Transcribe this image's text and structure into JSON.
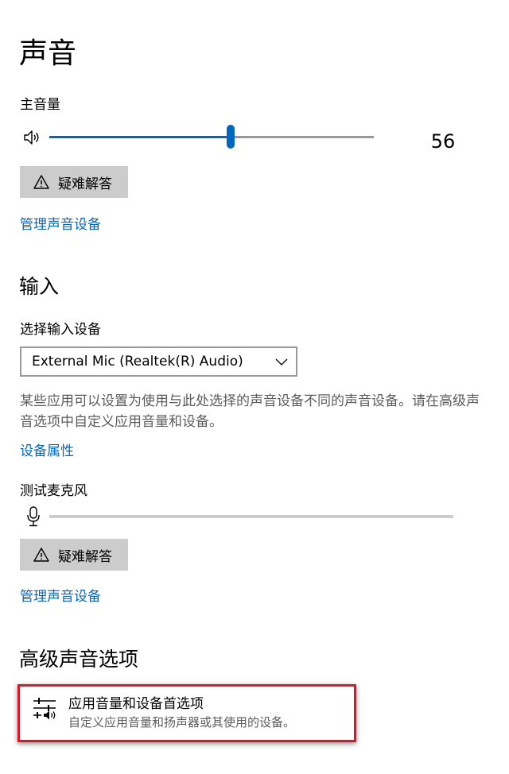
{
  "page": {
    "title": "声音"
  },
  "output": {
    "master_volume_label": "主音量",
    "volume_value": "56",
    "volume_level": 0.56,
    "troubleshoot_label": "疑难解答",
    "manage_devices_link": "管理声音设备"
  },
  "input": {
    "section_title": "输入",
    "choose_device_label": "选择输入设备",
    "selected_device": "External Mic (Realtek(R) Audio)",
    "description": "某些应用可以设置为使用与此处选择的声音设备不同的声音设备。请在高级声音选项中自定义应用音量和设备。",
    "device_properties_link": "设备属性",
    "test_mic_label": "测试麦克风",
    "mic_level": 0,
    "troubleshoot_label": "疑难解答",
    "manage_devices_link": "管理声音设备"
  },
  "advanced": {
    "section_title": "高级声音选项",
    "app_volume_title": "应用音量和设备首选项",
    "app_volume_subtitle": "自定义应用音量和扬声器或其使用的设备。"
  },
  "colors": {
    "accent": "#0067c0",
    "highlight_border": "#e81123",
    "button_bg": "#cccccc"
  },
  "icons": {
    "speaker": "speaker-icon",
    "warning": "warning-icon",
    "chevron": "chevron-down-icon",
    "mic": "microphone-icon",
    "app_volume": "equalizer-sliders-icon"
  }
}
